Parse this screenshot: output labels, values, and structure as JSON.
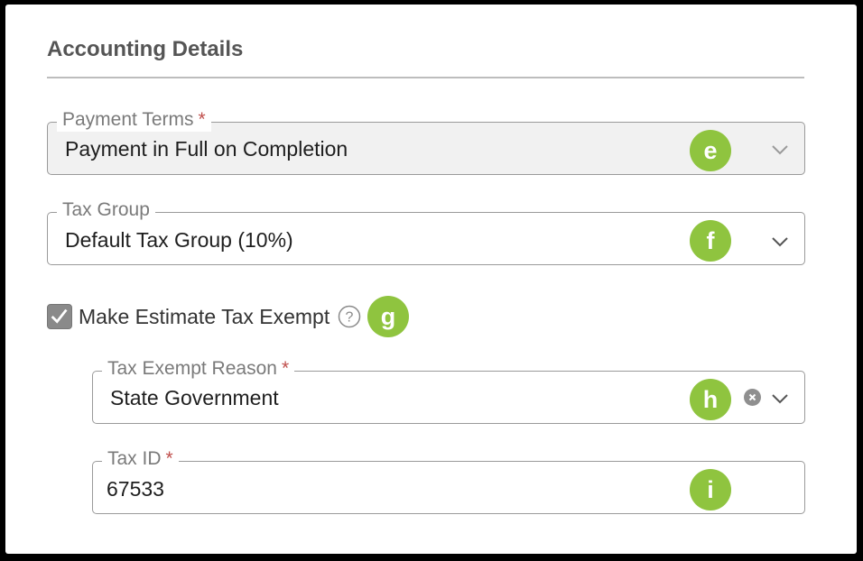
{
  "section": {
    "title": "Accounting Details"
  },
  "payment_terms": {
    "label": "Payment Terms",
    "required_mark": "*",
    "value": "Payment in Full on Completion",
    "marker": "e"
  },
  "tax_group": {
    "label": "Tax Group",
    "value": "Default Tax Group  (10%)",
    "marker": "f"
  },
  "tax_exempt_checkbox": {
    "label": "Make Estimate Tax Exempt",
    "checked": true,
    "marker": "g"
  },
  "tax_exempt_reason": {
    "label": "Tax Exempt Reason",
    "required_mark": "*",
    "value": "State Government",
    "marker": "h"
  },
  "tax_id": {
    "label": "Tax ID",
    "required_mark": "*",
    "value": "67533",
    "marker": "i"
  },
  "colors": {
    "marker": "#8fc43f",
    "required": "#c0504d",
    "border": "#9a9a9a",
    "disabled_bg": "#f1f1f1"
  },
  "icons": [
    "chevron-down-icon",
    "clear-icon",
    "help-icon",
    "checkmark-icon"
  ]
}
